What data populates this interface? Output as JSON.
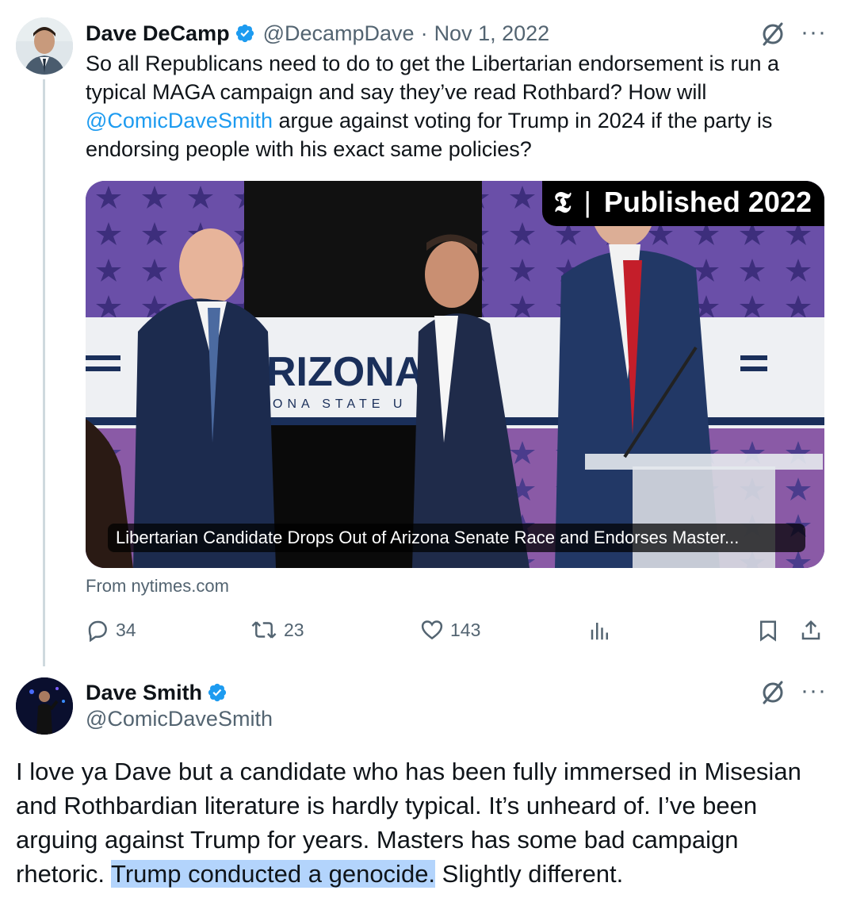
{
  "tweet1": {
    "name": "Dave DeCamp",
    "handle": "@DecampDave",
    "separator": "·",
    "date": "Nov 1, 2022",
    "text_before_mention": "So all Republicans need to do to get the Libertarian endorsement is run a typical MAGA campaign and say they’ve read Rothbard? How will ",
    "mention": "@ComicDaveSmith",
    "text_after_mention": " argue against voting for Trump in 2024 if the party is endorsing people with his exact same policies?",
    "card": {
      "badge_logo": "𝕿",
      "badge_divider": "|",
      "badge_text": "Published 2022",
      "backdrop_text": "RIZONA",
      "backdrop_subtext": "ONA STATE U",
      "caption": "Libertarian Candidate Drops Out of Arizona Senate Race and Endorses Master...",
      "source": "From nytimes.com"
    },
    "stats": {
      "replies": "34",
      "reposts": "23",
      "likes": "143"
    },
    "more": "···"
  },
  "tweet2": {
    "name": "Dave Smith",
    "handle": "@ComicDaveSmith",
    "text_before_highlight": "I love ya Dave but a candidate who has been fully immersed in Misesian and Rothbardian literature is hardly typical. It’s unheard of. I’ve been arguing against Trump for years. Masters has some bad campaign rhetoric. ",
    "highlight": "Trump conducted a genocide.",
    "text_after_highlight": " Slightly different.",
    "more": "···"
  },
  "colors": {
    "text": "#0f1419",
    "secondary": "#536471",
    "accent": "#1d9bf0",
    "highlight": "#b3d4fc"
  },
  "icons": [
    "verified-badge-icon",
    "grok-icon",
    "more-icon",
    "reply-icon",
    "repost-icon",
    "like-icon",
    "views-icon",
    "bookmark-icon",
    "share-icon"
  ]
}
